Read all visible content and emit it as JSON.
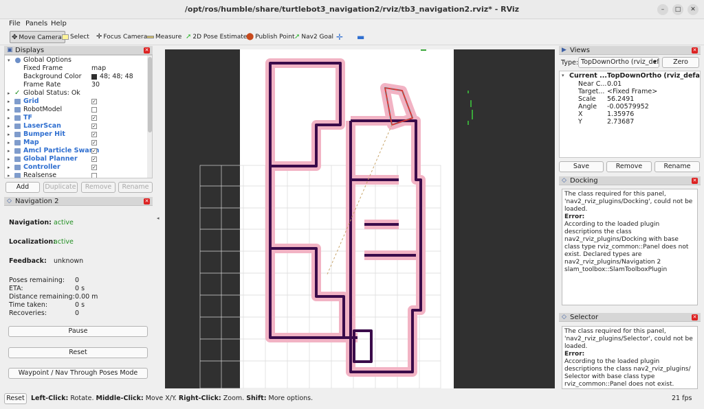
{
  "window": {
    "title": "/opt/ros/humble/share/turtlebot3_navigation2/rviz/tb3_navigation2.rviz* - RViz",
    "minimize": "–",
    "maximize": "□",
    "close": "✕"
  },
  "menu": {
    "file": "File",
    "panels": "Panels",
    "help": "Help"
  },
  "toolbar": {
    "move_camera": "Move Camera",
    "select": "Select",
    "focus_camera": "Focus Camera",
    "measure": "Measure",
    "pose_estimate": "2D Pose Estimate",
    "publish_point": "Publish Point",
    "nav2_goal": "Nav2 Goal"
  },
  "displays": {
    "title": "Displays",
    "global_options": {
      "label": "Global Options",
      "fixed_frame_label": "Fixed Frame",
      "fixed_frame_value": "map",
      "background_label": "Background Color",
      "background_value": "48; 48; 48",
      "framerate_label": "Frame Rate",
      "framerate_value": "30"
    },
    "global_status": "Global Status: Ok",
    "items": [
      {
        "label": "Grid",
        "checked": true,
        "blue": true
      },
      {
        "label": "RobotModel",
        "checked": false,
        "blue": false
      },
      {
        "label": "TF",
        "checked": true,
        "blue": true
      },
      {
        "label": "LaserScan",
        "checked": true,
        "blue": true
      },
      {
        "label": "Bumper Hit",
        "checked": true,
        "blue": true
      },
      {
        "label": "Map",
        "checked": true,
        "blue": true
      },
      {
        "label": "Amcl Particle Swarm",
        "checked": true,
        "blue": true
      },
      {
        "label": "Global Planner",
        "checked": true,
        "blue": true
      },
      {
        "label": "Controller",
        "checked": true,
        "blue": true
      },
      {
        "label": "Realsense",
        "checked": false,
        "blue": false
      }
    ],
    "buttons": {
      "add": "Add",
      "duplicate": "Duplicate",
      "remove": "Remove",
      "rename": "Rename"
    }
  },
  "navigation": {
    "title": "Navigation 2",
    "navigation_label": "Navigation:",
    "navigation_value": "active",
    "localization_label": "Localization:",
    "localization_value": "active",
    "feedback_label": "Feedback:",
    "feedback_value": "unknown",
    "poses_label": "Poses remaining:",
    "poses_value": "0",
    "eta_label": "ETA:",
    "eta_value": "0 s",
    "distance_label": "Distance remaining:",
    "distance_value": "0.00 m",
    "time_label": "Time taken:",
    "time_value": "0 s",
    "recoveries_label": "Recoveries:",
    "recoveries_value": "0",
    "pause": "Pause",
    "reset": "Reset",
    "mode": "Waypoint / Nav Through Poses Mode"
  },
  "views": {
    "title": "Views",
    "type_label": "Type:",
    "type_value": "TopDownOrtho (rviz_def",
    "zero": "Zero",
    "current_label": "Current ...",
    "current_value": "TopDownOrtho (rviz_defau...",
    "rows": [
      {
        "k": "Near C...",
        "v": "0.01"
      },
      {
        "k": "Target...",
        "v": "<Fixed Frame>"
      },
      {
        "k": "Scale",
        "v": "56.2491"
      },
      {
        "k": "Angle",
        "v": "-0.00579952"
      },
      {
        "k": "X",
        "v": "1.35976"
      },
      {
        "k": "Y",
        "v": "2.73687"
      }
    ],
    "save": "Save",
    "remove": "Remove",
    "rename": "Rename"
  },
  "docking": {
    "title": "Docking",
    "msg": "The class required for this panel, 'nav2_rviz_plugins/Docking', could not be loaded.",
    "error_label": "Error:",
    "detail": "According to the loaded plugin descriptions the class nav2_rviz_plugins/Docking with base class type rviz_common::Panel does not exist. Declared types are nav2_rviz_plugins/Navigation 2 slam_toolbox::SlamToolboxPlugin"
  },
  "selector": {
    "title": "Selector",
    "msg": "The class required for this panel, 'nav2_rviz_plugins/Selector', could not be loaded.",
    "error_label": "Error:",
    "detail": "According to the loaded plugin descriptions the class nav2_rviz_plugins/ Selector with base class type rviz_common::Panel does not exist."
  },
  "status": {
    "reset": "Reset",
    "left_click": "Left-Click:",
    "left_text": " Rotate. ",
    "middle_click": "Middle-Click:",
    "middle_text": " Move X/Y. ",
    "right_click": "Right-Click:",
    "right_text": " Zoom. ",
    "shift": "Shift:",
    "shift_text": " More options.",
    "fps": "21 fps"
  },
  "colors": {
    "viewport_bg": "#303030",
    "map_free": "#ffffff",
    "wall": "#3a0b4a",
    "inflation": "#f2b3c4",
    "costmap_cyan": "#64f0f8",
    "accent_blue": "#2f6fd0"
  }
}
